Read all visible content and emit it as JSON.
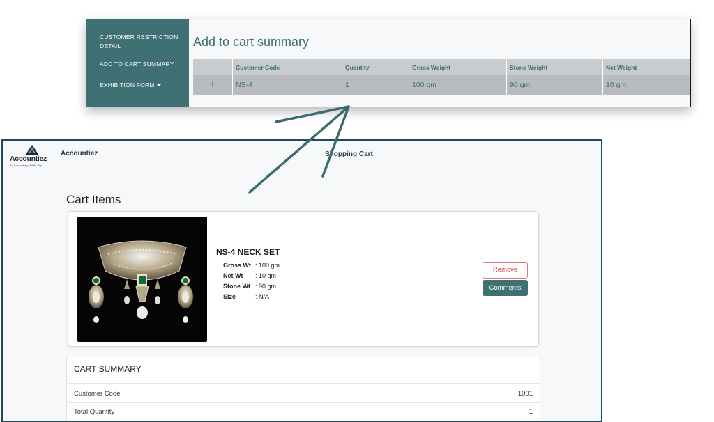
{
  "admin": {
    "sidebar": {
      "items": [
        {
          "label": "CUSTOMER RESTRICTION DETAIL"
        },
        {
          "label": "ADD TO CART SUMMARY"
        },
        {
          "label": "EXHIBITION FORM"
        }
      ]
    },
    "title": "Add to cart summary",
    "table": {
      "add_symbol": "+",
      "columns": [
        "Customer Code",
        "Quantity",
        "Gross Weight",
        "Stone Weight",
        "Net Weight"
      ],
      "rows": [
        [
          "NS-4",
          "1",
          "100 gm",
          "90 gm",
          "10 gm"
        ]
      ]
    }
  },
  "cart": {
    "logo_text": "Accountiez",
    "logo_tagline": "An Accounting Mobile Erp",
    "app_name": "Accountiez",
    "page_header": "Shopping Cart",
    "section_title": "Cart Items",
    "item": {
      "name": "NS-4 NECK SET",
      "specs": [
        {
          "label": "Gross Wt",
          "value": ": 100 gm"
        },
        {
          "label": "Net Wt",
          "value": ": 10 gm"
        },
        {
          "label": "Stone Wt",
          "value": ": 90 gm"
        },
        {
          "label": "Size",
          "value": ": N/A"
        }
      ],
      "remove_label": "Remove",
      "comments_label": "Comments"
    },
    "summary": {
      "title": "CART SUMMARY",
      "rows": [
        {
          "label": "Customer Code",
          "value": "1001"
        },
        {
          "label": "Total Quantity",
          "value": "1"
        }
      ]
    }
  },
  "colors": {
    "teal": "#3f7074",
    "teal_text": "#3d6e71",
    "frame_border": "#1f4a5c",
    "remove_red": "#d24a4a"
  }
}
